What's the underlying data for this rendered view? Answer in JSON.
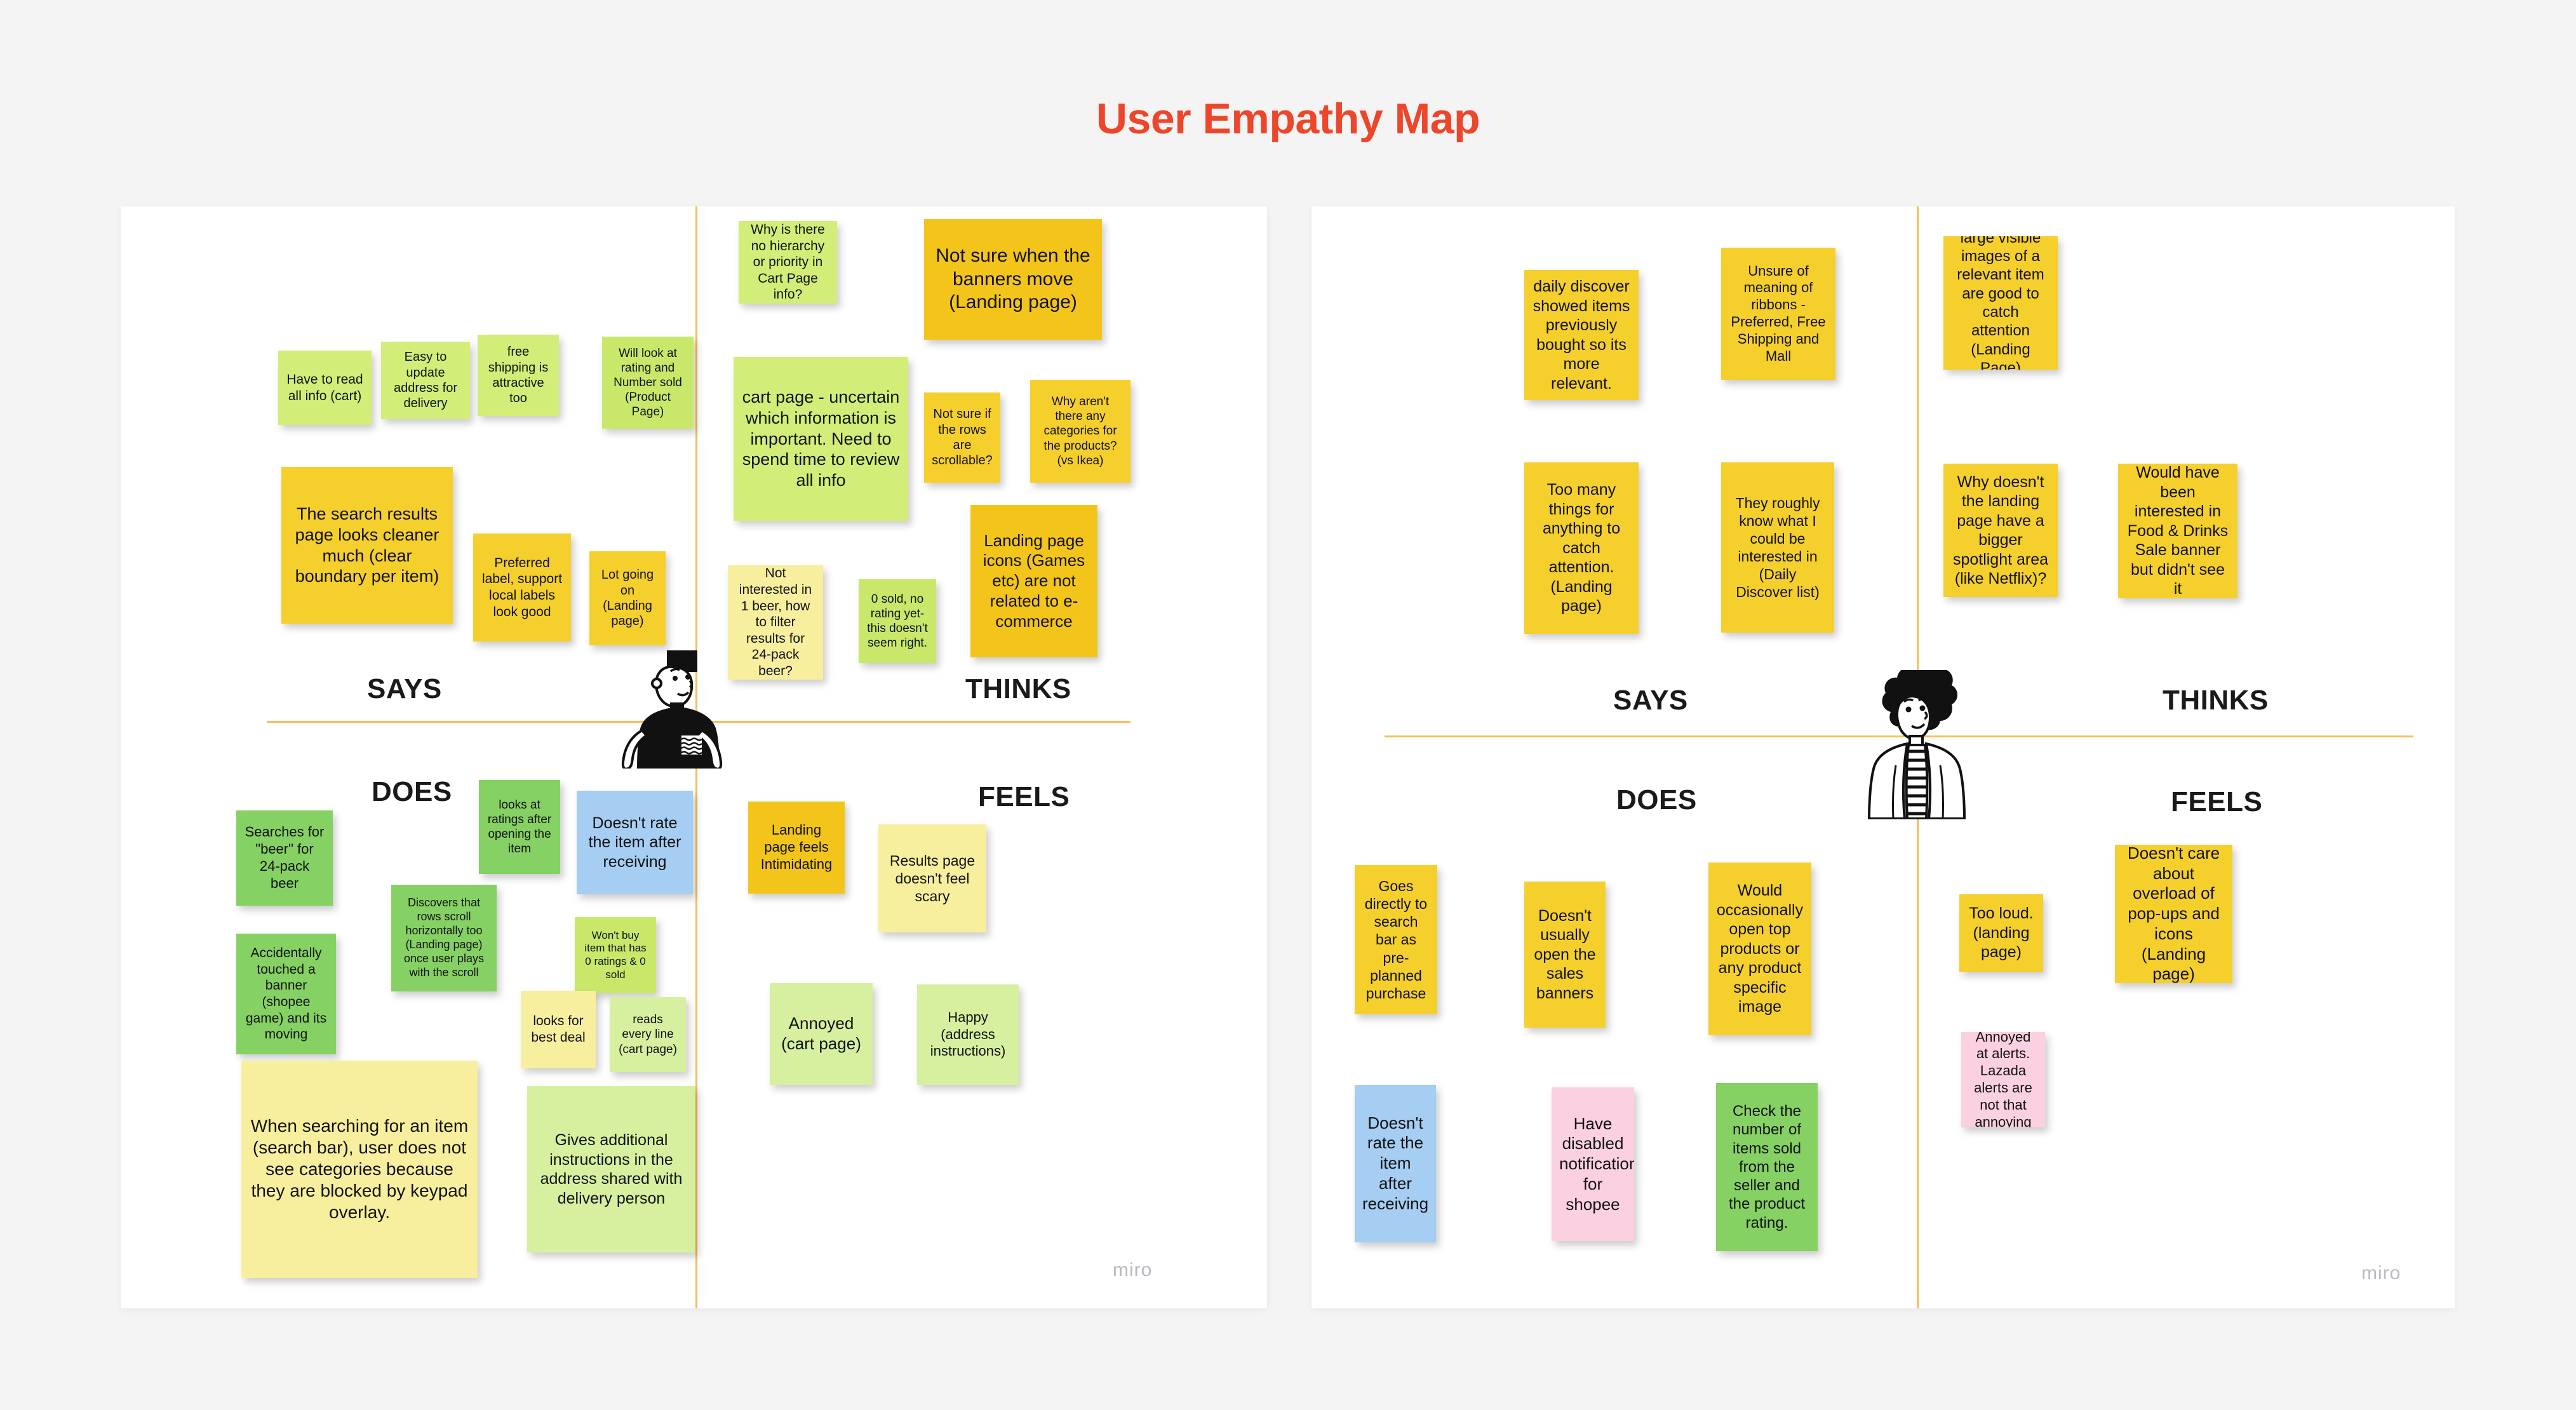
{
  "page": {
    "title": "User Empathy Map",
    "title_color": "#ed462a",
    "background_color": "#f4f4f4",
    "watermark": "miro"
  },
  "colors": {
    "note_yellow": "#f5cf2c",
    "note_yellow_deep": "#f3c51a",
    "note_lightyellow": "#f8ef9e",
    "note_green": "#d3ee78",
    "note_green_mid": "#c9e86a",
    "note_green_strong": "#85d163",
    "note_green_soft": "#d6f0a0",
    "note_blue": "#a6cdf2",
    "note_pink": "#fbd0e0",
    "divider": "#f5a623",
    "board": "#ffffff"
  },
  "boards": [
    {
      "id": "left",
      "avatar": "male-flattop-avatar",
      "quadrants": [
        {
          "id": "says",
          "label": "SAYS"
        },
        {
          "id": "thinks",
          "label": "THINKS"
        },
        {
          "id": "does",
          "label": "DOES"
        },
        {
          "id": "feels",
          "label": "FEELS"
        }
      ],
      "notes": {
        "says": [
          {
            "text": "Have to read all info (cart)",
            "color": "note_green"
          },
          {
            "text": "Easy to update address for delivery",
            "color": "note_green"
          },
          {
            "text": "free shipping is attractive too",
            "color": "note_green"
          },
          {
            "text": "Will look at rating and Number sold (Product Page)",
            "color": "note_green_mid"
          },
          {
            "text": "The search results page looks cleaner much (clear boundary per item)",
            "color": "note_yellow"
          },
          {
            "text": "Preferred label, support local labels look good",
            "color": "note_yellow"
          },
          {
            "text": "Lot going on (Landing page)",
            "color": "note_yellow"
          }
        ],
        "thinks": [
          {
            "text": "Why is there no hierarchy or priority in Cart Page info?",
            "color": "note_green"
          },
          {
            "text": "Not sure when the banners move (Landing page)",
            "color": "note_yellow_deep"
          },
          {
            "text": "cart page - uncertain which information is important. Need to spend time to review all info",
            "color": "note_green"
          },
          {
            "text": "Not sure if the rows are scrollable?",
            "color": "note_yellow"
          },
          {
            "text": "Why aren't there any categories for the products? (vs Ikea)",
            "color": "note_yellow"
          },
          {
            "text": "Not interested in 1 beer, how to filter results for 24-pack beer?",
            "color": "note_lightyellow"
          },
          {
            "text": "0 sold, no rating yet- this doesn't seem right.",
            "color": "note_green_mid"
          },
          {
            "text": "Landing page icons (Games etc) are not related to e-commerce",
            "color": "note_yellow_deep"
          }
        ],
        "does": [
          {
            "text": "Searches for \"beer\" for 24-pack beer",
            "color": "note_green_strong"
          },
          {
            "text": "looks at ratings after opening the item",
            "color": "note_green_strong"
          },
          {
            "text": "Doesn't rate the item after receiving",
            "color": "note_blue"
          },
          {
            "text": "Accidentally touched a banner (shopee game) and its moving",
            "color": "note_green_strong"
          },
          {
            "text": "Discovers that rows scroll horizontally too (Landing page) once user plays with the scroll",
            "color": "note_green_strong"
          },
          {
            "text": "Won't buy item that has 0 ratings & 0 sold",
            "color": "note_green_mid"
          },
          {
            "text": "looks for best deal",
            "color": "note_lightyellow"
          },
          {
            "text": "reads every line (cart page)",
            "color": "note_green_soft"
          },
          {
            "text": "When searching for an item (search bar), user does not see categories because they are blocked by keypad overlay.",
            "color": "note_lightyellow"
          },
          {
            "text": "Gives additional instructions in the address shared with delivery person",
            "color": "note_green_soft"
          }
        ],
        "feels": [
          {
            "text": "Landing page feels Intimidating",
            "color": "note_yellow_deep"
          },
          {
            "text": "Results page doesn't feel scary",
            "color": "note_lightyellow"
          },
          {
            "text": "Annoyed (cart page)",
            "color": "note_green_soft"
          },
          {
            "text": "Happy (address instructions)",
            "color": "note_green_soft"
          }
        ]
      }
    },
    {
      "id": "right",
      "avatar": "female-curlyhair-avatar",
      "quadrants": [
        {
          "id": "says",
          "label": "SAYS"
        },
        {
          "id": "thinks",
          "label": "THINKS"
        },
        {
          "id": "does",
          "label": "DOES"
        },
        {
          "id": "feels",
          "label": "FEELS"
        }
      ],
      "notes": {
        "says": [
          {
            "text": "daily discover showed items previously bought so its more relevant.",
            "color": "note_yellow"
          },
          {
            "text": "Unsure of meaning of ribbons - Preferred, Free Shipping and Mall",
            "color": "note_yellow"
          },
          {
            "text": "Too many things for anything to catch attention. (Landing page)",
            "color": "note_yellow"
          },
          {
            "text": "They roughly know what I could be interested in (Daily Discover list)",
            "color": "note_yellow"
          }
        ],
        "thinks": [
          {
            "text": "large visible images of a relevant item are good to catch attention (Landing Page)",
            "color": "note_yellow"
          },
          {
            "text": "Why doesn't the landing page have a bigger spotlight area (like Netflix)?",
            "color": "note_yellow"
          },
          {
            "text": "Would have been interested in Food & Drinks Sale banner but didn't see it",
            "color": "note_yellow"
          }
        ],
        "does": [
          {
            "text": "Goes directly to search bar as pre-planned purchase",
            "color": "note_yellow"
          },
          {
            "text": "Doesn't usually open the sales banners",
            "color": "note_yellow"
          },
          {
            "text": "Would occasionally open top products or any product specific image",
            "color": "note_yellow"
          },
          {
            "text": "Doesn't rate the item after receiving",
            "color": "note_blue"
          },
          {
            "text": "Have disabled notifications for shopee",
            "color": "note_pink"
          },
          {
            "text": "Check the number of items sold from the seller and the product rating.",
            "color": "note_green_strong"
          }
        ],
        "feels": [
          {
            "text": "Too loud. (landing page)",
            "color": "note_yellow"
          },
          {
            "text": "Doesn't care about overload of pop-ups and icons (Landing page)",
            "color": "note_yellow"
          },
          {
            "text": "Annoyed at alerts. Lazada alerts are not that annoying",
            "color": "note_pink"
          }
        ]
      }
    }
  ]
}
